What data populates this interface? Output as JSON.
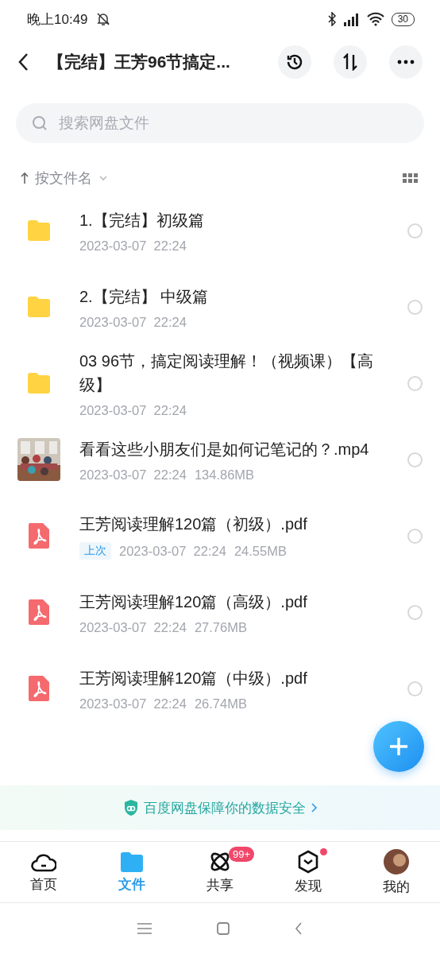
{
  "status_bar": {
    "time": "晚上10:49",
    "battery": "30"
  },
  "header": {
    "title": "【完结】王芳96节搞定..."
  },
  "search": {
    "placeholder": "搜索网盘文件"
  },
  "sort": {
    "label": "按文件名"
  },
  "files": [
    {
      "kind": "folder",
      "name": "1.【完结】初级篇",
      "date": "2023-03-07  22:24",
      "selected": false
    },
    {
      "kind": "folder",
      "name": "2.【完结】 中级篇",
      "date": "2023-03-07  22:24",
      "selected": false
    },
    {
      "kind": "folder",
      "name": "03  96节，搞定阅读理解！（视频课）【高级】",
      "date": "2023-03-07  22:24",
      "selected": false
    },
    {
      "kind": "video",
      "name": "看看这些小朋友们是如何记笔记的？.mp4",
      "date": "2023-03-07  22:24",
      "size": "134.86MB",
      "selected": false
    },
    {
      "kind": "pdf",
      "name": "王芳阅读理解120篇（初级）.pdf",
      "tag": "上次",
      "date": "2023-03-07  22:24",
      "size": "24.55MB",
      "selected": false
    },
    {
      "kind": "pdf",
      "name": "王芳阅读理解120篇（高级）.pdf",
      "date": "2023-03-07  22:24",
      "size": "27.76MB",
      "selected": false
    },
    {
      "kind": "pdf",
      "name": "王芳阅读理解120篇（中级）.pdf",
      "date": "2023-03-07  22:24",
      "size": "26.74MB",
      "selected": false
    }
  ],
  "banner": {
    "text": "百度网盘保障你的数据安全"
  },
  "tabs": [
    {
      "kind": "home",
      "label": "首页",
      "selected": false
    },
    {
      "kind": "files",
      "label": "文件",
      "selected": true
    },
    {
      "kind": "share",
      "label": "共享",
      "selected": false,
      "badge": "99+"
    },
    {
      "kind": "discover",
      "label": "发现",
      "selected": false,
      "dot": true
    },
    {
      "kind": "me",
      "label": "我的",
      "selected": false
    }
  ]
}
